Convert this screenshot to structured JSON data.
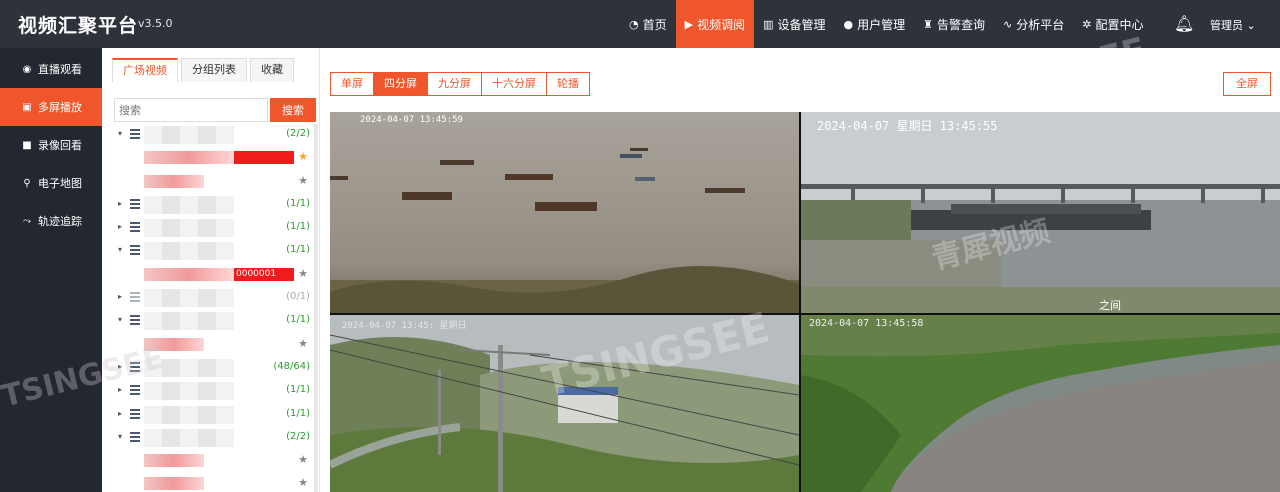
{
  "app": {
    "title": "视频汇聚平台",
    "version": "v3.5.0"
  },
  "nav": [
    {
      "label": "首页",
      "icon": "dashboard-icon",
      "active": false
    },
    {
      "label": "视频调阅",
      "icon": "play-circle-icon",
      "active": true
    },
    {
      "label": "设备管理",
      "icon": "device-icon",
      "active": false
    },
    {
      "label": "用户管理",
      "icon": "user-icon",
      "active": false
    },
    {
      "label": "告警查询",
      "icon": "alarm-icon",
      "active": false
    },
    {
      "label": "分析平台",
      "icon": "pulse-icon",
      "active": false
    },
    {
      "label": "配置中心",
      "icon": "gear-icon",
      "active": false
    }
  ],
  "user": {
    "name": "管理员"
  },
  "sidebar": [
    {
      "label": "直播观看",
      "icon": "live-icon",
      "active": false
    },
    {
      "label": "多屏播放",
      "icon": "multiscreen-icon",
      "active": true
    },
    {
      "label": "录像回看",
      "icon": "record-icon",
      "active": false
    },
    {
      "label": "电子地图",
      "icon": "map-pin-icon",
      "active": false
    },
    {
      "label": "轨迹追踪",
      "icon": "track-icon",
      "active": false
    }
  ],
  "panel": {
    "tabs": [
      "广场视频",
      "分组列表",
      "收藏"
    ],
    "active_tab": 0,
    "search_placeholder": "搜索",
    "search_button": "搜索",
    "tree": [
      {
        "kind": "group",
        "expanded": true,
        "count": "(2/2)",
        "status": "online"
      },
      {
        "kind": "channel",
        "starred": true,
        "suffix": ""
      },
      {
        "kind": "channel",
        "starred": false,
        "suffix": ""
      },
      {
        "kind": "group",
        "expanded": false,
        "count": "(1/1)",
        "status": "online"
      },
      {
        "kind": "group",
        "expanded": false,
        "count": "(1/1)",
        "status": "online"
      },
      {
        "kind": "group",
        "expanded": true,
        "count": "(1/1)",
        "status": "online"
      },
      {
        "kind": "channel",
        "starred": false,
        "suffix": "0000001"
      },
      {
        "kind": "group",
        "expanded": false,
        "count": "(0/1)",
        "status": "offline"
      },
      {
        "kind": "group",
        "expanded": true,
        "count": "(1/1)",
        "status": "online"
      },
      {
        "kind": "channel",
        "starred": false,
        "suffix": ""
      },
      {
        "kind": "group",
        "expanded": false,
        "count": "(48/64)",
        "status": "online"
      },
      {
        "kind": "group",
        "expanded": false,
        "count": "(1/1)",
        "status": "online"
      },
      {
        "kind": "group",
        "expanded": false,
        "count": "(1/1)",
        "status": "online"
      },
      {
        "kind": "group",
        "expanded": true,
        "count": "(2/2)",
        "status": "online"
      },
      {
        "kind": "channel",
        "starred": false,
        "suffix": ""
      },
      {
        "kind": "channel",
        "starred": false,
        "suffix": ""
      }
    ]
  },
  "toolbar": {
    "split_modes": [
      "单屏",
      "四分屏",
      "九分屏",
      "十六分屏",
      "轮播"
    ],
    "active_split": 1,
    "fullscreen": "全屏"
  },
  "videos": [
    {
      "timestamp": "2024-04-07 13:45:59",
      "caption": ""
    },
    {
      "timestamp": "2024-04-07  星期日  13:45:55",
      "caption": "之间"
    },
    {
      "timestamp": "2024-04-07 13:45:  星期日",
      "caption": ""
    },
    {
      "timestamp": "2024-04-07 13:45:58",
      "caption": ""
    }
  ],
  "watermarks": [
    "TSINGSEE",
    "青犀视频"
  ],
  "colors": {
    "accent": "#f0562c",
    "topbar": "#2e333b",
    "sidebar": "#232830",
    "online": "#2a9d2a"
  }
}
